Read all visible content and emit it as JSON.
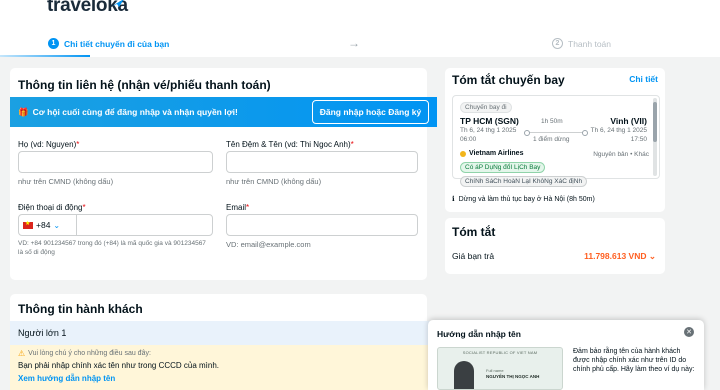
{
  "header": {
    "logo": "traveloka",
    "step1_num": "1",
    "step1_label": "Chi tiết chuyến đi của bạn",
    "step2_num": "2",
    "step2_label": "Thanh toán"
  },
  "contact": {
    "title": "Thông tin liên hệ (nhận vé/phiếu thanh toán)",
    "login_banner_text": "Cơ hội cuối cùng để đăng nhập và nhận quyền lợi!",
    "login_button": "Đăng nhập hoặc Đăng ký",
    "last_name_label": "Họ (vd: Nguyen)",
    "last_name_value": "",
    "last_name_hint": "như trên CMND (không dấu)",
    "first_name_label": "Tên Đệm & Tên (vd: Thi Ngoc Anh)",
    "first_name_value": "",
    "first_name_hint": "như trên CMND (không dấu)",
    "phone_label": "Điện thoại di động",
    "phone_code": "+84",
    "phone_value": "",
    "phone_hint": "VD: +84 901234567 trong đó (+84) là mã quốc gia và 901234567 là số di động",
    "email_label": "Email",
    "email_value": "",
    "email_hint": "VD: email@example.com",
    "required_mark": "*"
  },
  "passenger": {
    "title": "Thông tin hành khách",
    "adult_label": "Người lớn 1",
    "warn_small": "Vui lòng chú ý cho những điều sau đây:",
    "warn_main": "Bạn phải nhập chính xác tên như trong CCCD của mình.",
    "warn_link": "Xem hướng dẫn nhập tên"
  },
  "flight_summary": {
    "title": "Tóm tắt chuyến bay",
    "detail_link": "Chi tiết",
    "depart_tag": "Chuyến bay đi",
    "from_city": "TP HCM (SGN)",
    "from_date": "Th 6, 24 thg 1 2025",
    "from_time": "06:00",
    "duration": "1h 50m",
    "stops": "1 điểm dừng",
    "to_city": "Vinh (VII)",
    "to_date": "Th 6, 24 thg 1 2025",
    "to_time": "17:50",
    "airline": "Vietnam Airlines",
    "fare_type": "Nguyên bản • Khác",
    "tag_refund": "Có áP DụNg đổI LịCh Bay",
    "tag_policy": "ChíNh SáCh HoàN LạI KhôNg XáC địNh",
    "stop_note": "Dừng và làm thủ tục bay ở Hà Nội (8h 50m)"
  },
  "total": {
    "title": "Tóm tắt",
    "price_label": "Giá bạn trả",
    "price_value": "11.798.613 VND"
  },
  "guide": {
    "title": "Hướng dẫn nhập tên",
    "id_header": "SOCIALIST REPUBLIC OF VIET NAM",
    "id_name_label": "Full name",
    "id_name": "NGUYỄN THỊ NGỌC ANH",
    "text": "Đảm bảo rằng tên của hành khách được nhập chính xác như trên ID do chính phủ cấp. Hãy làm theo ví dụ này:"
  },
  "colors": {
    "accent": "#0194f3",
    "price": "#ff5e1f",
    "warning_bg": "#fff6d9"
  },
  "icons": [
    "bird-logo-icon",
    "arrow-right-icon",
    "gift-icon",
    "flag-vn-icon",
    "chevron-down-icon",
    "warning-icon",
    "airline-icon",
    "info-icon",
    "close-icon",
    "plane-stop-icon"
  ]
}
